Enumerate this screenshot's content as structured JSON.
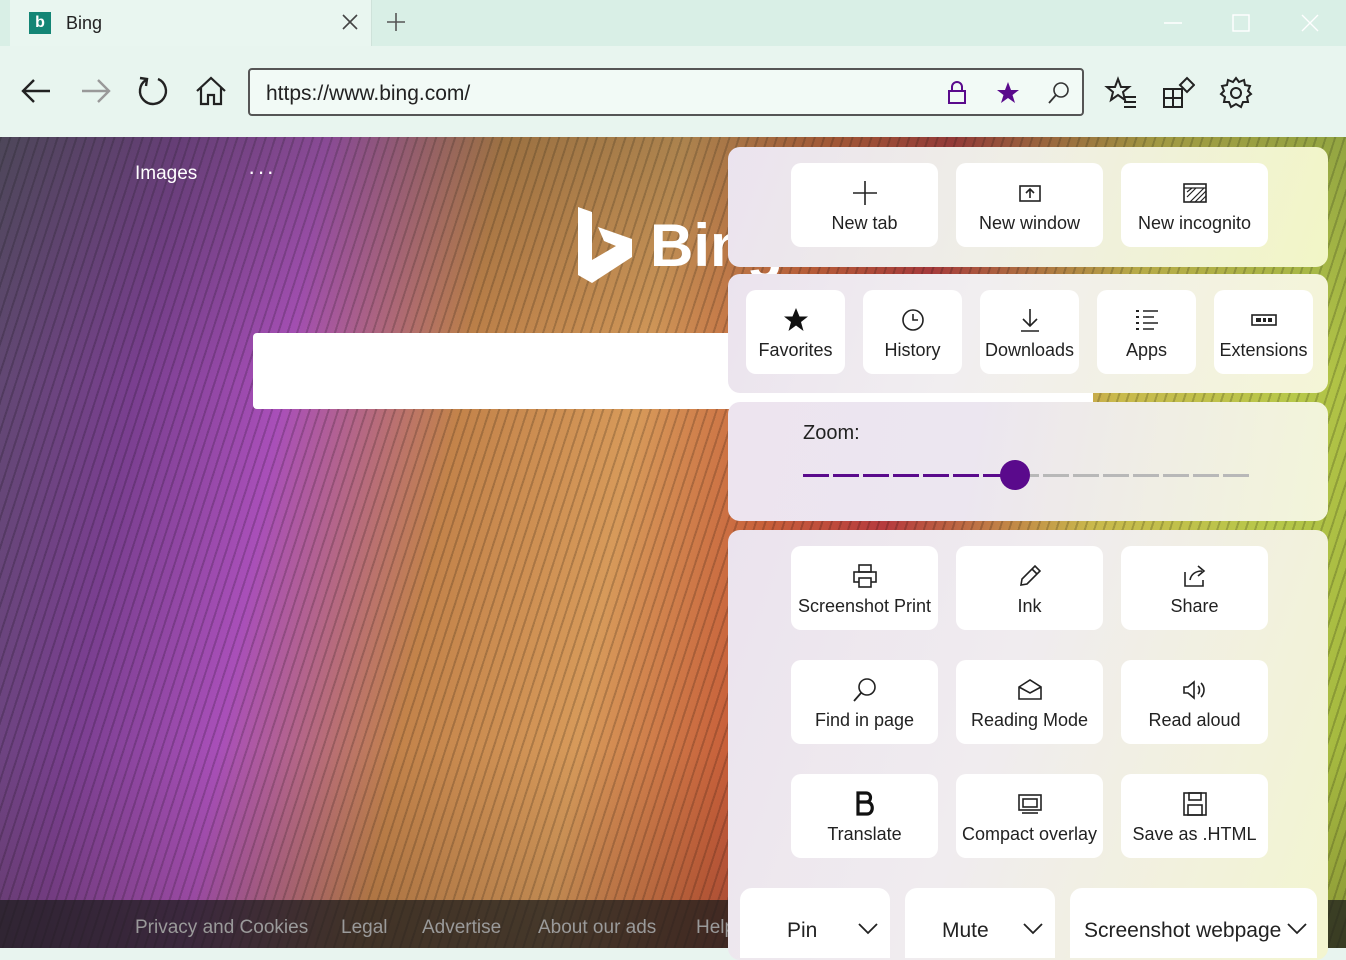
{
  "tab": {
    "title": "Bing",
    "favicon_letter": "b"
  },
  "address": {
    "url": "https://www.bing.com/"
  },
  "colors": {
    "accent": "#5a0a8c",
    "zoom_inactive": "#b8b8b8"
  },
  "page": {
    "nav_images": "Images",
    "more": "···",
    "logo_text": "Bing",
    "footer_links": [
      "Privacy and Cookies",
      "Legal",
      "Advertise",
      "About our ads",
      "Help"
    ]
  },
  "menu": {
    "top_row": [
      {
        "label": "New tab",
        "icon": "plus-icon"
      },
      {
        "label": "New window",
        "icon": "new-window-icon"
      },
      {
        "label": "New incognito",
        "icon": "incognito-icon"
      }
    ],
    "second_row": [
      {
        "label": "Favorites",
        "icon": "star-icon"
      },
      {
        "label": "History",
        "icon": "clock-icon"
      },
      {
        "label": "Downloads",
        "icon": "download-icon"
      },
      {
        "label": "Apps",
        "icon": "apps-list-icon"
      },
      {
        "label": "Extensions",
        "icon": "extensions-icon"
      }
    ],
    "zoom": {
      "label": "Zoom:",
      "steps": 15,
      "level_index": 7
    },
    "tools": [
      {
        "label": "Screenshot Print",
        "icon": "printer-icon"
      },
      {
        "label": "Ink",
        "icon": "pen-icon"
      },
      {
        "label": "Share",
        "icon": "share-icon"
      },
      {
        "label": "Find in page",
        "icon": "search-icon"
      },
      {
        "label": "Reading Mode",
        "icon": "reading-mode-icon"
      },
      {
        "label": "Read aloud",
        "icon": "speaker-icon"
      },
      {
        "label": "Translate",
        "icon": "bold-b-icon"
      },
      {
        "label": "Compact overlay",
        "icon": "compact-overlay-icon"
      },
      {
        "label": "Save as .HTML",
        "icon": "save-icon"
      }
    ],
    "dropdowns": [
      {
        "label": "Pin"
      },
      {
        "label": "Mute"
      },
      {
        "label": "Screenshot webpage"
      }
    ]
  }
}
